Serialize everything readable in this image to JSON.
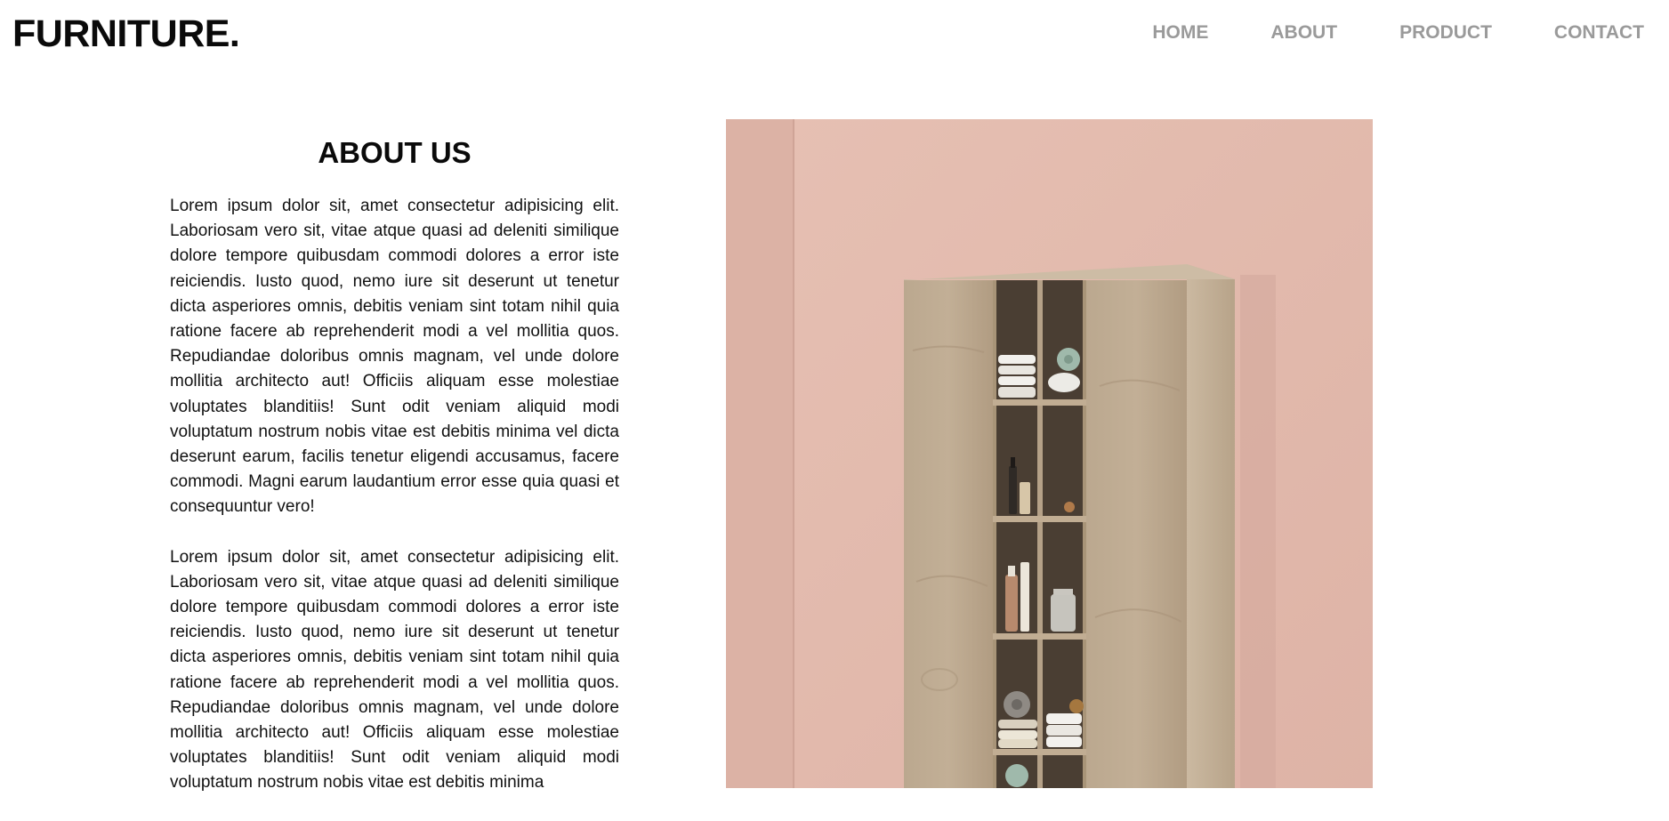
{
  "brand": {
    "logo": "FURNITURE."
  },
  "nav": {
    "items": [
      {
        "label": "HOME"
      },
      {
        "label": "ABOUT"
      },
      {
        "label": "PRODUCT"
      },
      {
        "label": "CONTACT"
      }
    ]
  },
  "about": {
    "title": "ABOUT US",
    "paragraphs": [
      "Lorem ipsum dolor sit, amet consectetur adipisicing elit. Laboriosam vero sit, vitae atque quasi ad deleniti similique dolore tempore quibusdam commodi dolores a error iste reiciendis. Iusto quod, nemo iure sit deserunt ut tenetur dicta asperiores omnis, debitis veniam sint totam nihil quia ratione facere ab reprehenderit modi a vel mollitia quos. Repudiandae doloribus omnis magnam, vel unde dolore mollitia architecto aut! Officiis aliquam esse molestiae voluptates blanditiis! Sunt odit veniam aliquid modi voluptatum nostrum nobis vitae est debitis minima vel dicta deserunt earum, facilis tenetur eligendi accusamus, facere commodi. Magni earum laudantium error esse quia quasi et consequuntur vero!",
      "Lorem ipsum dolor sit, amet consectetur adipisicing elit. Laboriosam vero sit, vitae atque quasi ad deleniti similique dolore tempore quibusdam commodi dolores a error iste reiciendis. Iusto quod, nemo iure sit deserunt ut tenetur dicta asperiores omnis, debitis veniam sint totam nihil quia ratione facere ab reprehenderit modi a vel mollitia quos. Repudiandae doloribus omnis magnam, vel unde dolore mollitia architecto aut! Officiis aliquam esse molestiae voluptates blanditiis! Sunt odit veniam aliquid modi voluptatum nostrum nobis vitae est debitis minima"
    ]
  },
  "colors": {
    "wall": "#e2b8ab",
    "wood": "#b9a48a",
    "nav_text": "#9a9a9a"
  }
}
